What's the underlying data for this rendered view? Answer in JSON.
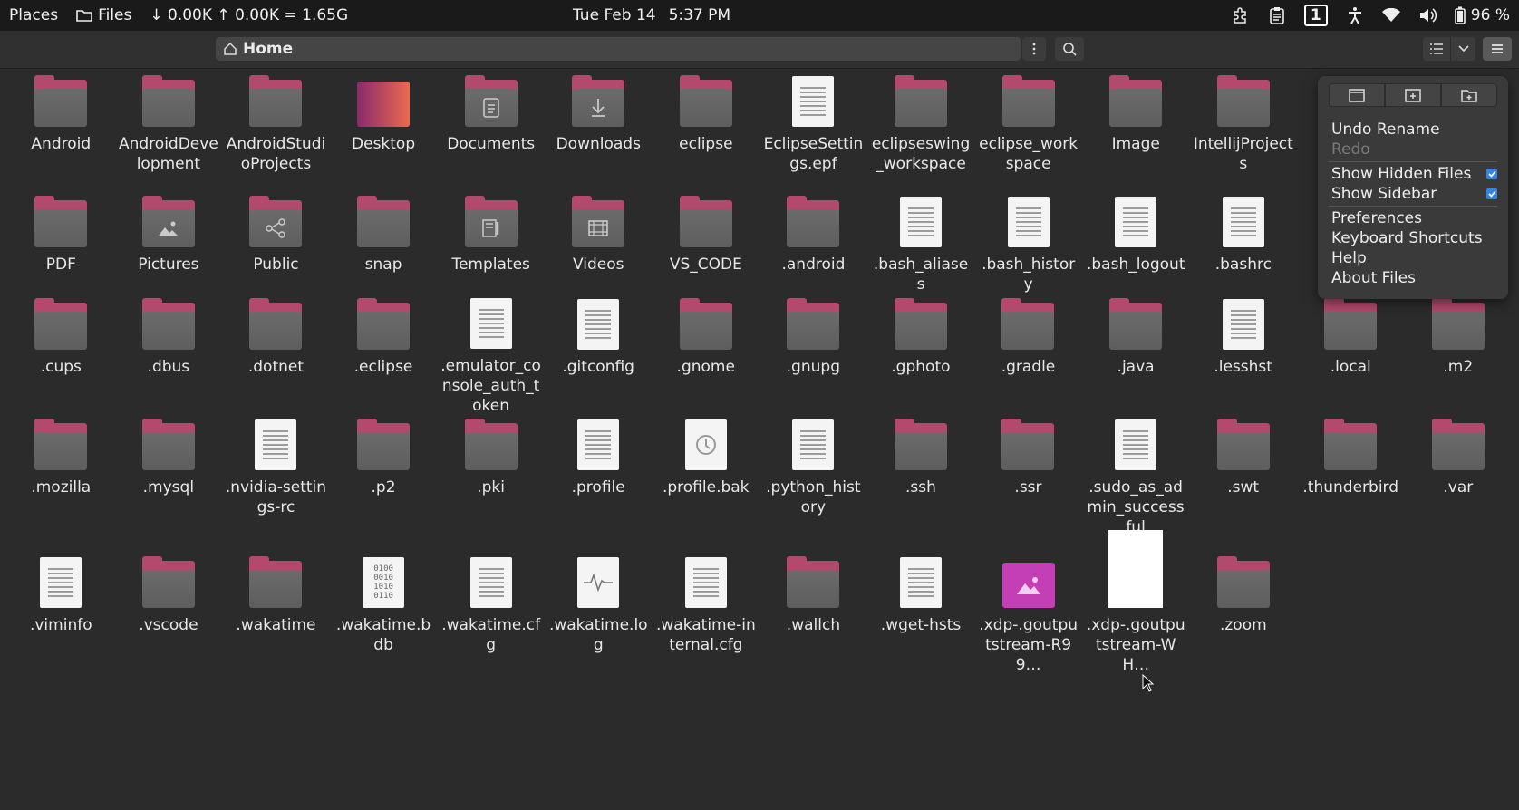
{
  "topbar": {
    "places": "Places",
    "files": "Files",
    "netspeed": "↓ 0.00K ↑ 0.00K = 1.65G",
    "date": "Tue Feb 14",
    "time": "5:37 PM",
    "workspace": "1",
    "battery": "96 %"
  },
  "header": {
    "path": "Home"
  },
  "files": [
    [
      {
        "name": "Android",
        "kind": "folder"
      },
      {
        "name": "AndroidDevelopment",
        "kind": "folder"
      },
      {
        "name": "AndroidStudioProjects",
        "kind": "folder"
      },
      {
        "name": "Desktop",
        "kind": "desktop"
      },
      {
        "name": "Documents",
        "kind": "folder-docs"
      },
      {
        "name": "Downloads",
        "kind": "folder-down"
      },
      {
        "name": "eclipse",
        "kind": "folder"
      },
      {
        "name": "EclipseSettings.epf",
        "kind": "doc"
      },
      {
        "name": "eclipseswing_workspace",
        "kind": "folder"
      },
      {
        "name": "eclipse_workspace",
        "kind": "folder"
      },
      {
        "name": "Image",
        "kind": "folder"
      },
      {
        "name": "IntellijProjects",
        "kind": "folder"
      }
    ],
    [
      {
        "name": "PDF",
        "kind": "folder"
      },
      {
        "name": "Pictures",
        "kind": "folder-pics"
      },
      {
        "name": "Public",
        "kind": "folder-share"
      },
      {
        "name": "snap",
        "kind": "folder"
      },
      {
        "name": "Templates",
        "kind": "folder-tmpl"
      },
      {
        "name": "Videos",
        "kind": "folder-video"
      },
      {
        "name": "VS_CODE",
        "kind": "folder"
      },
      {
        "name": ".android",
        "kind": "folder"
      },
      {
        "name": ".bash_aliases",
        "kind": "doc"
      },
      {
        "name": ".bash_history",
        "kind": "doc"
      },
      {
        "name": ".bash_logout",
        "kind": "doc"
      },
      {
        "name": ".bashrc",
        "kind": "doc"
      }
    ],
    [
      {
        "name": ".cups",
        "kind": "folder"
      },
      {
        "name": ".dbus",
        "kind": "folder"
      },
      {
        "name": ".dotnet",
        "kind": "folder"
      },
      {
        "name": ".eclipse",
        "kind": "folder"
      },
      {
        "name": ".emulator_console_auth_token",
        "kind": "doc"
      },
      {
        "name": ".gitconfig",
        "kind": "doc"
      },
      {
        "name": ".gnome",
        "kind": "folder"
      },
      {
        "name": ".gnupg",
        "kind": "folder"
      },
      {
        "name": ".gphoto",
        "kind": "folder"
      },
      {
        "name": ".gradle",
        "kind": "folder"
      },
      {
        "name": ".java",
        "kind": "folder"
      },
      {
        "name": ".lesshst",
        "kind": "doc"
      },
      {
        "name": ".local",
        "kind": "folder"
      },
      {
        "name": ".m2",
        "kind": "folder"
      }
    ],
    [
      {
        "name": ".mozilla",
        "kind": "folder"
      },
      {
        "name": ".mysql",
        "kind": "folder"
      },
      {
        "name": ".nvidia-settings-rc",
        "kind": "doc"
      },
      {
        "name": ".p2",
        "kind": "folder"
      },
      {
        "name": ".pki",
        "kind": "folder"
      },
      {
        "name": ".profile",
        "kind": "doc"
      },
      {
        "name": ".profile.bak",
        "kind": "doc-bak"
      },
      {
        "name": ".python_history",
        "kind": "doc"
      },
      {
        "name": ".ssh",
        "kind": "folder"
      },
      {
        "name": ".ssr",
        "kind": "folder"
      },
      {
        "name": ".sudo_as_admin_successful",
        "kind": "doc"
      },
      {
        "name": ".swt",
        "kind": "folder"
      },
      {
        "name": ".thunderbird",
        "kind": "folder"
      },
      {
        "name": ".var",
        "kind": "folder"
      }
    ],
    [
      {
        "name": ".viminfo",
        "kind": "doc"
      },
      {
        "name": ".vscode",
        "kind": "folder"
      },
      {
        "name": ".wakatime",
        "kind": "folder"
      },
      {
        "name": ".wakatime.bdb",
        "kind": "doc-bin"
      },
      {
        "name": ".wakatime.cfg",
        "kind": "doc"
      },
      {
        "name": ".wakatime.log",
        "kind": "doc-log"
      },
      {
        "name": ".wakatime-internal.cfg",
        "kind": "doc"
      },
      {
        "name": ".wallch",
        "kind": "folder"
      },
      {
        "name": ".wget-hsts",
        "kind": "doc"
      },
      {
        "name": ".xdp-.goutputstream-R99…",
        "kind": "image"
      },
      {
        "name": ".xdp-.goutputstream-WH…",
        "kind": "blank"
      },
      {
        "name": ".zoom",
        "kind": "folder"
      }
    ]
  ],
  "menu": {
    "undo": "Undo Rename",
    "redo": "Redo",
    "hidden": "Show Hidden Files",
    "sidebar": "Show Sidebar",
    "prefs": "Preferences",
    "shortcuts": "Keyboard Shortcuts",
    "help": "Help",
    "about": "About Files"
  }
}
